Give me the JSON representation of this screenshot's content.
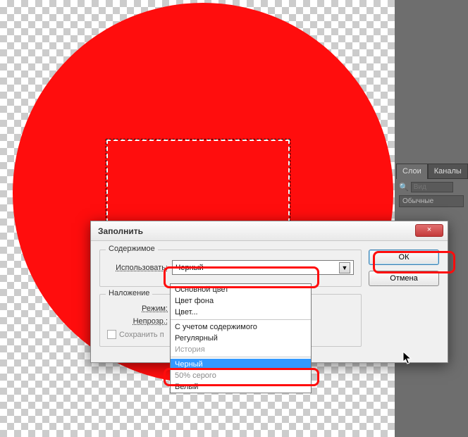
{
  "panels": {
    "tabs": [
      "Слои",
      "Каналы"
    ],
    "search_placeholder": "Вид",
    "blend_mode": "Обычные"
  },
  "dialog": {
    "title": "Заполнить",
    "close_symbol": "×",
    "group_content": "Содержимое",
    "use_label": "Использовать:",
    "use_value": "Черный",
    "group_blend": "Наложение",
    "mode_label": "Режим:",
    "opacity_label": "Непрозр.:",
    "save_label": "Сохранить п",
    "ok": "ОК",
    "cancel": "Отмена"
  },
  "dropdown": {
    "items": [
      {
        "text": "Основной цвет",
        "state": "normal"
      },
      {
        "text": "Цвет фона",
        "state": "normal"
      },
      {
        "text": "Цвет...",
        "state": "normal"
      },
      {
        "sep": true
      },
      {
        "text": "С учетом содержимого",
        "state": "normal"
      },
      {
        "text": "Регулярный",
        "state": "normal"
      },
      {
        "text": "История",
        "state": "disabled"
      },
      {
        "sep": true
      },
      {
        "text": "Черный",
        "state": "selected"
      },
      {
        "text": "50% серого",
        "state": "obscured"
      },
      {
        "text": "Белый",
        "state": "normal"
      }
    ]
  },
  "cursor_glyph": "↖"
}
